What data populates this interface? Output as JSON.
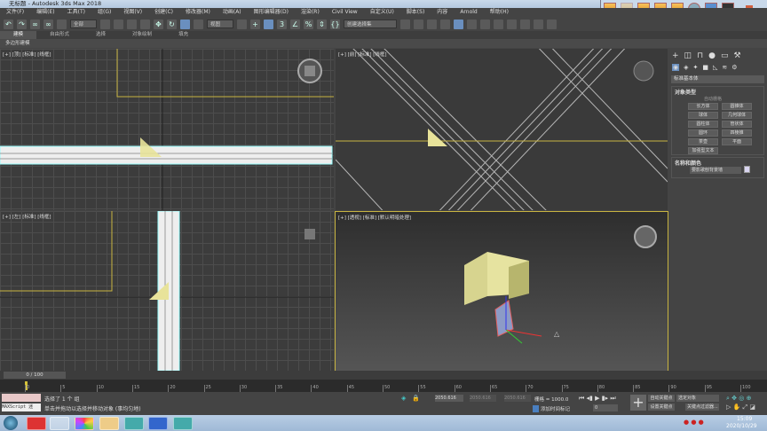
{
  "window": {
    "title": "无标题 - Autodesk 3ds Max 2018"
  },
  "menu": [
    "文件(F)",
    "编辑(E)",
    "工具(T)",
    "组(G)",
    "视图(V)",
    "创建(C)",
    "修改器(M)",
    "动画(A)",
    "图形编辑器(D)",
    "渲染(R)",
    "Civil View",
    "自定义(U)",
    "脚本(S)",
    "内容",
    "Arnold",
    "帮助(H)"
  ],
  "toolbar": {
    "filter_dropdown": "全部",
    "coord_dropdown": "视图",
    "selection_set": "创建选择集"
  },
  "ribbon": {
    "tabs": [
      "建模",
      "自由形式",
      "选择",
      "对象绘制",
      "填充"
    ],
    "sub_label": "多边形建模"
  },
  "viewports": {
    "top_left": "[+] [顶] [标准] [线框]",
    "top_right": "[+] [前] [标准] [线框]",
    "bottom_left": "[+] [左] [标准] [线框]",
    "bottom_right": "[+] [透视] [标准] [默认明暗处理]"
  },
  "command_panel": {
    "category_dropdown": "标准基本体",
    "object_type_header": "对象类型",
    "autogrid": "自动栅格",
    "buttons": [
      "长方体",
      "圆锥体",
      "球体",
      "几何球体",
      "圆柱体",
      "管状体",
      "圆环",
      "四棱锥",
      "茶壶",
      "平面",
      "加强型文本"
    ],
    "name_color_header": "名称和颜色",
    "object_name": "要影歌刨背景墙",
    "object_color": "#d8d4f0"
  },
  "timeline": {
    "frame_counter": "0 / 100",
    "ticks": [
      "0",
      "5",
      "10",
      "15",
      "20",
      "25",
      "30",
      "35",
      "40",
      "45",
      "50",
      "55",
      "60",
      "65",
      "70",
      "75",
      "80",
      "85",
      "90",
      "95",
      "100"
    ]
  },
  "status": {
    "maxscript": "MAXScript 迷",
    "selection_info": "选择了 1 个 组",
    "prompt": "单击并拖动以选择并移动对象 (事均匀地)",
    "x": "2050.616",
    "y": "2050.616",
    "z": "2050.616",
    "grid": "栅格 = 1000.0",
    "add_time_tag": "添加时间标记",
    "auto_key": "自动关键点",
    "set_key": "设置关键点",
    "key_target": "选定对象",
    "key_filters": "关键点过滤器...",
    "frame_field": "0"
  },
  "taskbar": {
    "time": "15:09",
    "date": "2020/10/29"
  },
  "colors": {
    "active_border": "#c8b441",
    "selection_yellow": "#e8e39a",
    "grid_bg": "#3c3c3c"
  }
}
